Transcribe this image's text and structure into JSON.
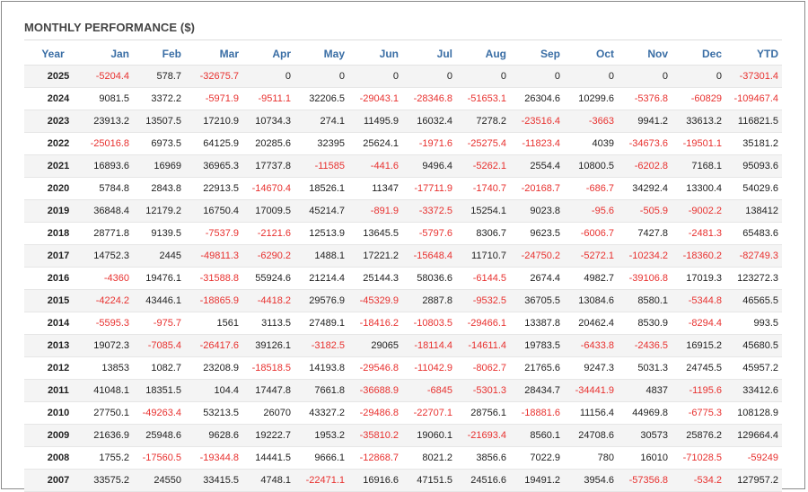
{
  "title": "MONTHLY PERFORMANCE ($)",
  "colors": {
    "negative": "#e8312f",
    "header": "#3a6ea5"
  },
  "columns": [
    "Year",
    "Jan",
    "Feb",
    "Mar",
    "Apr",
    "May",
    "Jun",
    "Jul",
    "Aug",
    "Sep",
    "Oct",
    "Nov",
    "Dec",
    "YTD"
  ],
  "rows": [
    [
      "2025",
      "-5204.4",
      "578.7",
      "-32675.7",
      "0",
      "0",
      "0",
      "0",
      "0",
      "0",
      "0",
      "0",
      "0",
      "-37301.4"
    ],
    [
      "2024",
      "9081.5",
      "3372.2",
      "-5971.9",
      "-9511.1",
      "32206.5",
      "-29043.1",
      "-28346.8",
      "-51653.1",
      "26304.6",
      "10299.6",
      "-5376.8",
      "-60829",
      "-109467.4"
    ],
    [
      "2023",
      "23913.2",
      "13507.5",
      "17210.9",
      "10734.3",
      "274.1",
      "11495.9",
      "16032.4",
      "7278.2",
      "-23516.4",
      "-3663",
      "9941.2",
      "33613.2",
      "116821.5"
    ],
    [
      "2022",
      "-25016.8",
      "6973.5",
      "64125.9",
      "20285.6",
      "32395",
      "25624.1",
      "-1971.6",
      "-25275.4",
      "-11823.4",
      "4039",
      "-34673.6",
      "-19501.1",
      "35181.2"
    ],
    [
      "2021",
      "16893.6",
      "16969",
      "36965.3",
      "17737.8",
      "-11585",
      "-441.6",
      "9496.4",
      "-5262.1",
      "2554.4",
      "10800.5",
      "-6202.8",
      "7168.1",
      "95093.6"
    ],
    [
      "2020",
      "5784.8",
      "2843.8",
      "22913.5",
      "-14670.4",
      "18526.1",
      "11347",
      "-17711.9",
      "-1740.7",
      "-20168.7",
      "-686.7",
      "34292.4",
      "13300.4",
      "54029.6"
    ],
    [
      "2019",
      "36848.4",
      "12179.2",
      "16750.4",
      "17009.5",
      "45214.7",
      "-891.9",
      "-3372.5",
      "15254.1",
      "9023.8",
      "-95.6",
      "-505.9",
      "-9002.2",
      "138412"
    ],
    [
      "2018",
      "28771.8",
      "9139.5",
      "-7537.9",
      "-2121.6",
      "12513.9",
      "13645.5",
      "-5797.6",
      "8306.7",
      "9623.5",
      "-6006.7",
      "7427.8",
      "-2481.3",
      "65483.6"
    ],
    [
      "2017",
      "14752.3",
      "2445",
      "-49811.3",
      "-6290.2",
      "1488.1",
      "17221.2",
      "-15648.4",
      "11710.7",
      "-24750.2",
      "-5272.1",
      "-10234.2",
      "-18360.2",
      "-82749.3"
    ],
    [
      "2016",
      "-4360",
      "19476.1",
      "-31588.8",
      "55924.6",
      "21214.4",
      "25144.3",
      "58036.6",
      "-6144.5",
      "2674.4",
      "4982.7",
      "-39106.8",
      "17019.3",
      "123272.3"
    ],
    [
      "2015",
      "-4224.2",
      "43446.1",
      "-18865.9",
      "-4418.2",
      "29576.9",
      "-45329.9",
      "2887.8",
      "-9532.5",
      "36705.5",
      "13084.6",
      "8580.1",
      "-5344.8",
      "46565.5"
    ],
    [
      "2014",
      "-5595.3",
      "-975.7",
      "1561",
      "3113.5",
      "27489.1",
      "-18416.2",
      "-10803.5",
      "-29466.1",
      "13387.8",
      "20462.4",
      "8530.9",
      "-8294.4",
      "993.5"
    ],
    [
      "2013",
      "19072.3",
      "-7085.4",
      "-26417.6",
      "39126.1",
      "-3182.5",
      "29065",
      "-18114.4",
      "-14611.4",
      "19783.5",
      "-6433.8",
      "-2436.5",
      "16915.2",
      "45680.5"
    ],
    [
      "2012",
      "13853",
      "1082.7",
      "23208.9",
      "-18518.5",
      "14193.8",
      "-29546.8",
      "-11042.9",
      "-8062.7",
      "21765.6",
      "9247.3",
      "5031.3",
      "24745.5",
      "45957.2"
    ],
    [
      "2011",
      "41048.1",
      "18351.5",
      "104.4",
      "17447.8",
      "7661.8",
      "-36688.9",
      "-6845",
      "-5301.3",
      "28434.7",
      "-34441.9",
      "4837",
      "-1195.6",
      "33412.6"
    ],
    [
      "2010",
      "27750.1",
      "-49263.4",
      "53213.5",
      "26070",
      "43327.2",
      "-29486.8",
      "-22707.1",
      "28756.1",
      "-18881.6",
      "11156.4",
      "44969.8",
      "-6775.3",
      "108128.9"
    ],
    [
      "2009",
      "21636.9",
      "25948.6",
      "9628.6",
      "19222.7",
      "1953.2",
      "-35810.2",
      "19060.1",
      "-21693.4",
      "8560.1",
      "24708.6",
      "30573",
      "25876.2",
      "129664.4"
    ],
    [
      "2008",
      "1755.2",
      "-17560.5",
      "-19344.8",
      "14441.5",
      "9666.1",
      "-12868.7",
      "8021.2",
      "3856.6",
      "7022.9",
      "780",
      "16010",
      "-71028.5",
      "-59249"
    ],
    [
      "2007",
      "33575.2",
      "24550",
      "33415.5",
      "4748.1",
      "-22471.1",
      "16916.6",
      "47151.5",
      "24516.6",
      "19491.2",
      "3954.6",
      "-57356.8",
      "-534.2",
      "127957.2"
    ]
  ]
}
